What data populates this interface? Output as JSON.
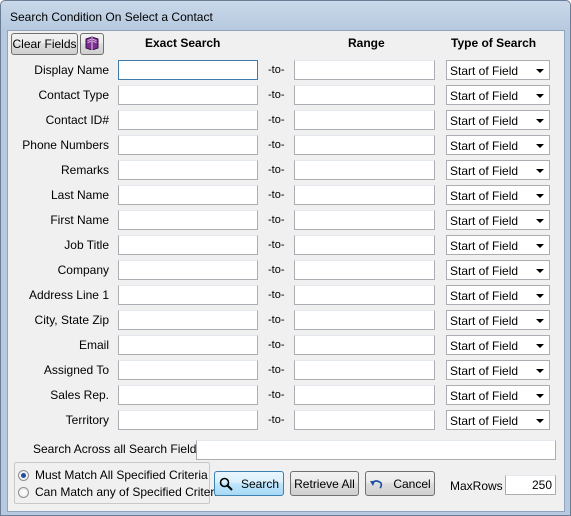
{
  "window": {
    "title": "Search Condition On Select a Contact"
  },
  "toolbar": {
    "clear_fields": "Clear Fields",
    "book_icon": "book-icon"
  },
  "headers": {
    "exact": "Exact Search",
    "range": "Range",
    "type": "Type of Search"
  },
  "separator": "-to-",
  "rows": [
    {
      "label": "Display Name",
      "exact": "",
      "range": "",
      "type": "Start of Field"
    },
    {
      "label": "Contact Type",
      "exact": "",
      "range": "",
      "type": "Start of Field"
    },
    {
      "label": "Contact ID#",
      "exact": "",
      "range": "",
      "type": "Start of Field"
    },
    {
      "label": "Phone Numbers",
      "exact": "",
      "range": "",
      "type": "Start of Field"
    },
    {
      "label": "Remarks",
      "exact": "",
      "range": "",
      "type": "Start of Field"
    },
    {
      "label": "Last Name",
      "exact": "",
      "range": "",
      "type": "Start of Field"
    },
    {
      "label": "First Name",
      "exact": "",
      "range": "",
      "type": "Start of Field"
    },
    {
      "label": "Job Title",
      "exact": "",
      "range": "",
      "type": "Start of Field"
    },
    {
      "label": "Company",
      "exact": "",
      "range": "",
      "type": "Start of Field"
    },
    {
      "label": "Address Line 1",
      "exact": "",
      "range": "",
      "type": "Start of Field"
    },
    {
      "label": "City, State  Zip",
      "exact": "",
      "range": "",
      "type": "Start of Field"
    },
    {
      "label": "Email",
      "exact": "",
      "range": "",
      "type": "Start of Field"
    },
    {
      "label": "Assigned To",
      "exact": "",
      "range": "",
      "type": "Start of Field"
    },
    {
      "label": "Sales Rep.",
      "exact": "",
      "range": "",
      "type": "Start of Field"
    },
    {
      "label": "Territory",
      "exact": "",
      "range": "",
      "type": "Start of Field"
    }
  ],
  "search_across": {
    "label": "Search Across all Search Fields",
    "value": ""
  },
  "match": {
    "options": [
      "Must Match All Specified Criteria",
      "Can Match any of Specified Criteria"
    ],
    "selected": "Must Match All Specified Criteria"
  },
  "buttons": {
    "search": "Search",
    "retrieve_all": "Retrieve All",
    "cancel": "Cancel"
  },
  "maxrows": {
    "label": "MaxRows",
    "value": "250"
  }
}
